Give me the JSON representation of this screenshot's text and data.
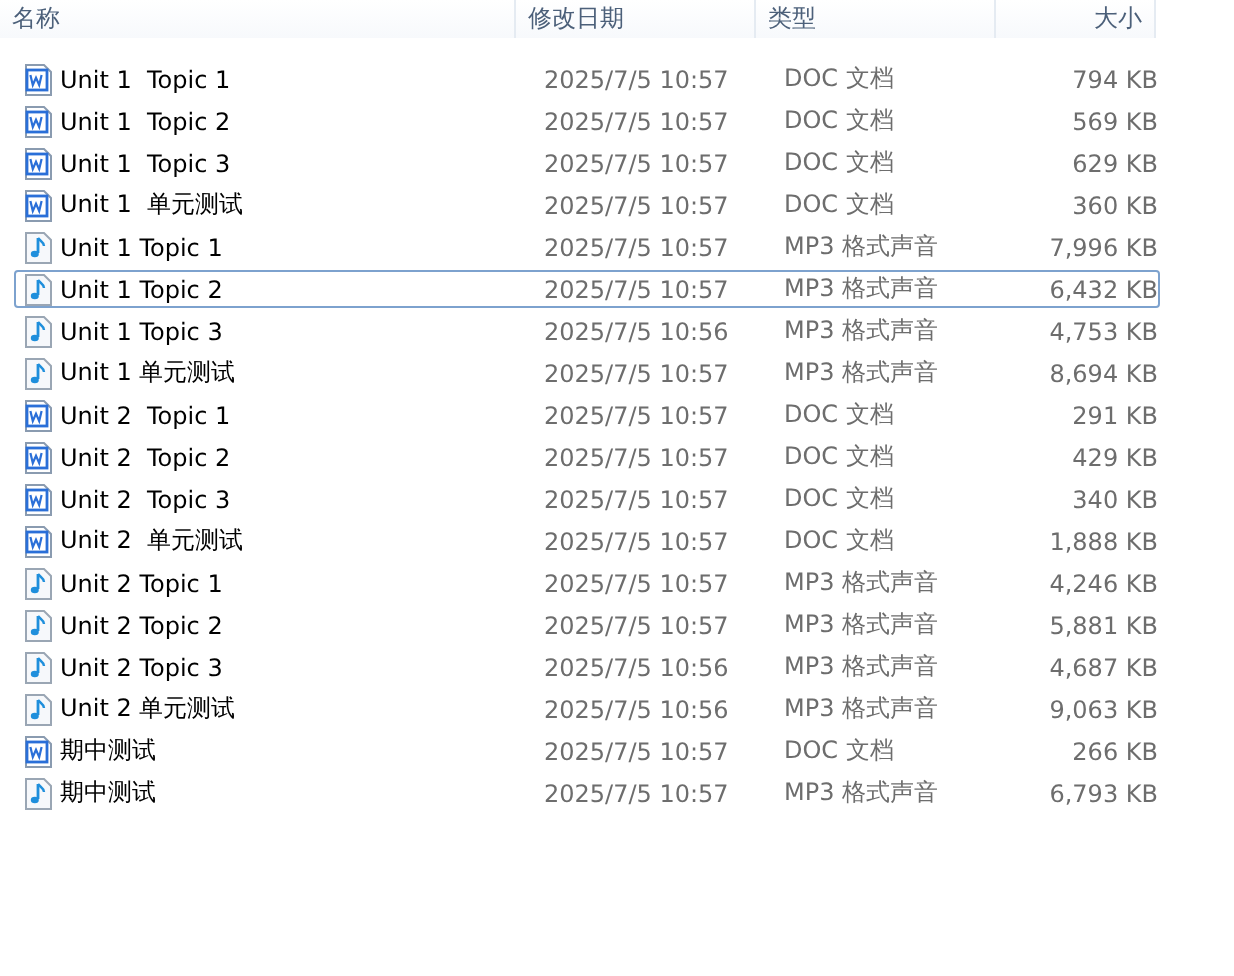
{
  "columns": [
    "名称",
    "修改日期",
    "类型",
    "大小"
  ],
  "files": [
    {
      "kind": "doc",
      "name": "Unit 1  Topic 1",
      "modified": "2025/7/5 10:57",
      "type": "DOC 文档",
      "size": "794 KB",
      "selected": false
    },
    {
      "kind": "doc",
      "name": "Unit 1  Topic 2",
      "modified": "2025/7/5 10:57",
      "type": "DOC 文档",
      "size": "569 KB",
      "selected": false
    },
    {
      "kind": "doc",
      "name": "Unit 1  Topic 3",
      "modified": "2025/7/5 10:57",
      "type": "DOC 文档",
      "size": "629 KB",
      "selected": false
    },
    {
      "kind": "doc",
      "name": "Unit 1  单元测试",
      "modified": "2025/7/5 10:57",
      "type": "DOC 文档",
      "size": "360 KB",
      "selected": false
    },
    {
      "kind": "mp3",
      "name": "Unit 1 Topic 1",
      "modified": "2025/7/5 10:57",
      "type": "MP3 格式声音",
      "size": "7,996 KB",
      "selected": false
    },
    {
      "kind": "mp3",
      "name": "Unit 1 Topic 2",
      "modified": "2025/7/5 10:57",
      "type": "MP3 格式声音",
      "size": "6,432 KB",
      "selected": true
    },
    {
      "kind": "mp3",
      "name": "Unit 1 Topic 3",
      "modified": "2025/7/5 10:56",
      "type": "MP3 格式声音",
      "size": "4,753 KB",
      "selected": false
    },
    {
      "kind": "mp3",
      "name": "Unit 1 单元测试",
      "modified": "2025/7/5 10:57",
      "type": "MP3 格式声音",
      "size": "8,694 KB",
      "selected": false
    },
    {
      "kind": "doc",
      "name": "Unit 2  Topic 1",
      "modified": "2025/7/5 10:57",
      "type": "DOC 文档",
      "size": "291 KB",
      "selected": false
    },
    {
      "kind": "doc",
      "name": "Unit 2  Topic 2",
      "modified": "2025/7/5 10:57",
      "type": "DOC 文档",
      "size": "429 KB",
      "selected": false
    },
    {
      "kind": "doc",
      "name": "Unit 2  Topic 3",
      "modified": "2025/7/5 10:57",
      "type": "DOC 文档",
      "size": "340 KB",
      "selected": false
    },
    {
      "kind": "doc",
      "name": "Unit 2  单元测试",
      "modified": "2025/7/5 10:57",
      "type": "DOC 文档",
      "size": "1,888 KB",
      "selected": false
    },
    {
      "kind": "mp3",
      "name": "Unit 2 Topic 1",
      "modified": "2025/7/5 10:57",
      "type": "MP3 格式声音",
      "size": "4,246 KB",
      "selected": false
    },
    {
      "kind": "mp3",
      "name": "Unit 2 Topic 2",
      "modified": "2025/7/5 10:57",
      "type": "MP3 格式声音",
      "size": "5,881 KB",
      "selected": false
    },
    {
      "kind": "mp3",
      "name": "Unit 2 Topic 3",
      "modified": "2025/7/5 10:56",
      "type": "MP3 格式声音",
      "size": "4,687 KB",
      "selected": false
    },
    {
      "kind": "mp3",
      "name": "Unit 2 单元测试",
      "modified": "2025/7/5 10:56",
      "type": "MP3 格式声音",
      "size": "9,063 KB",
      "selected": false
    },
    {
      "kind": "doc",
      "name": "期中测试",
      "modified": "2025/7/5 10:57",
      "type": "DOC 文档",
      "size": "266 KB",
      "selected": false
    },
    {
      "kind": "mp3",
      "name": "期中测试",
      "modified": "2025/7/5 10:57",
      "type": "MP3 格式声音",
      "size": "6,793 KB",
      "selected": false
    }
  ]
}
